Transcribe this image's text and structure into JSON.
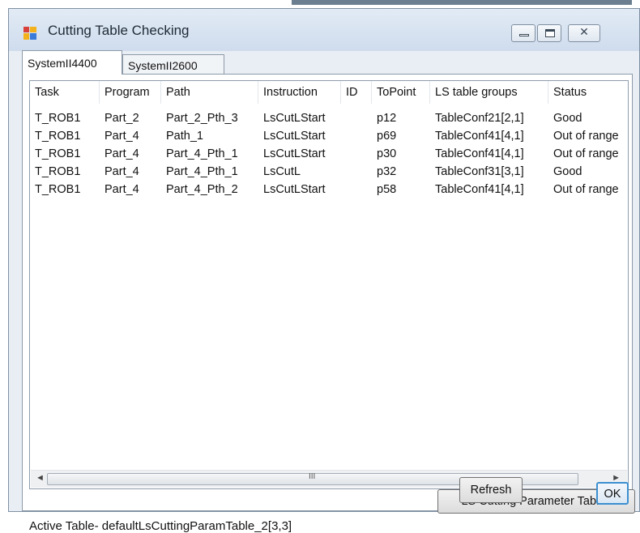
{
  "window": {
    "title": "Cutting Table Checking",
    "caption_buttons": {
      "minimize": "—",
      "maximize": "▭",
      "close": "✕"
    }
  },
  "tabs": [
    {
      "label": "SystemII4400",
      "active": true
    },
    {
      "label": "SystemII2600",
      "active": false
    }
  ],
  "table": {
    "columns": [
      "Task",
      "Program",
      "Path",
      "Instruction",
      "ID",
      "ToPoint",
      "LS table groups",
      "Status"
    ],
    "rows": [
      {
        "task": "T_ROB1",
        "program": "Part_2",
        "path": "Part_2_Pth_3",
        "instruction": "LsCutLStart",
        "id": "",
        "topoint": "p12",
        "ls_table_groups": "TableConf21[2,1]",
        "status": "Good"
      },
      {
        "task": "T_ROB1",
        "program": "Part_4",
        "path": "Path_1",
        "instruction": "LsCutLStart",
        "id": "",
        "topoint": "p69",
        "ls_table_groups": "TableConf41[4,1]",
        "status": "Out of range"
      },
      {
        "task": "T_ROB1",
        "program": "Part_4",
        "path": "Part_4_Pth_1",
        "instruction": "LsCutLStart",
        "id": "",
        "topoint": "p30",
        "ls_table_groups": "TableConf41[4,1]",
        "status": "Out of range"
      },
      {
        "task": "T_ROB1",
        "program": "Part_4",
        "path": "Part_4_Pth_1",
        "instruction": "LsCutL",
        "id": "",
        "topoint": "p32",
        "ls_table_groups": "TableConf31[3,1]",
        "status": "Good"
      },
      {
        "task": "T_ROB1",
        "program": "Part_4",
        "path": "Part_4_Pth_2",
        "instruction": "LsCutLStart",
        "id": "",
        "topoint": "p58",
        "ls_table_groups": "TableConf41[4,1]",
        "status": "Out of range"
      }
    ]
  },
  "scrollbar": {
    "left_arrow": "◄",
    "right_arrow": "►",
    "grip": "III"
  },
  "footer": {
    "active_table": "Active Table- defaultLsCuttingParamTable_2[3,3]",
    "ls_params_button": "LS Cutting Parameter Tables",
    "refresh_button": "Refresh",
    "ok_button": "OK"
  }
}
